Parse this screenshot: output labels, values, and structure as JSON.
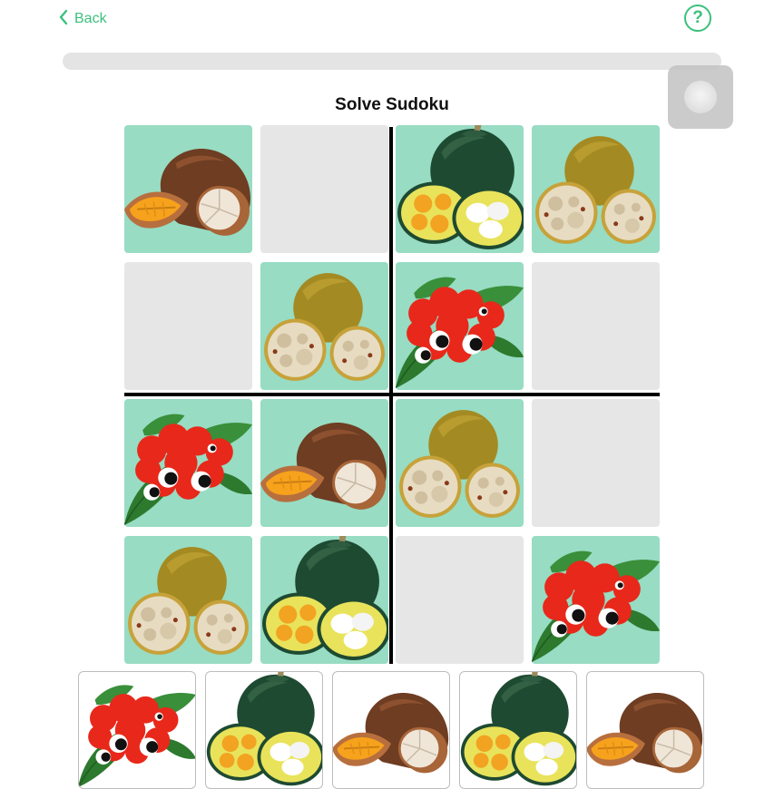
{
  "nav": {
    "back_label": "Back",
    "help_label": "?"
  },
  "progress": {
    "value": 0
  },
  "title": "Solve Sudoku",
  "colors": {
    "accent": "#3cc07e",
    "filled_cell": "#97dcc3",
    "empty_cell": "#e6e6e6"
  },
  "board": {
    "rows": [
      [
        "sapote",
        "",
        "ugli",
        "langsat"
      ],
      [
        "",
        "langsat",
        "guarana",
        ""
      ],
      [
        "guarana",
        "sapote",
        "langsat",
        ""
      ],
      [
        "langsat",
        "ugli",
        "",
        "guarana"
      ]
    ]
  },
  "choices": [
    "guarana",
    "ugli",
    "sapote",
    "ugli",
    "sapote"
  ]
}
